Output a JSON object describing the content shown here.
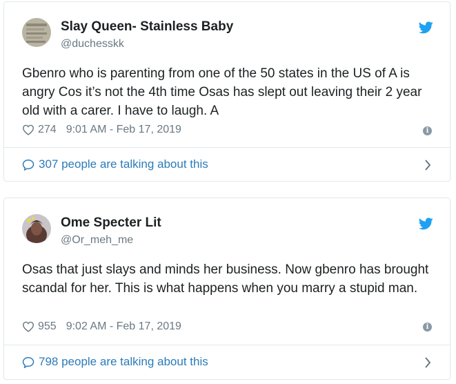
{
  "tweets": [
    {
      "name": "Slay Queen- Stainless Baby",
      "handle": "@duchesskk",
      "text": "Gbenro who is parenting from one of the 50 states in the US of A is angry Cos it’s not the 4th time Osas has slept out leaving their 2 year old with a carer. I have to laugh. A",
      "likes": "274",
      "timestamp": "9:01 AM - Feb 17, 2019",
      "talking": "307 people are talking about this",
      "icons": {
        "like": "heart-icon",
        "info": "info-icon",
        "brand": "twitter-bird-icon",
        "reply": "speech-bubble-icon",
        "more": "chevron-right-icon"
      }
    },
    {
      "name": "Ome Specter Lit",
      "handle": "@Or_meh_me",
      "text": "Osas that just slays and minds her business. Now gbenro has brought scandal for her. This is what happens when you marry a stupid man.",
      "likes": "955",
      "timestamp": "9:02 AM - Feb 17, 2019",
      "talking": "798 people are talking about this",
      "icons": {
        "like": "heart-icon",
        "info": "info-icon",
        "brand": "twitter-bird-icon",
        "reply": "speech-bubble-icon",
        "more": "chevron-right-icon"
      }
    }
  ],
  "colors": {
    "text": "#1c2022",
    "muted": "#697882",
    "link": "#2b7bb9",
    "brand": "#1da1f2",
    "border": "#e1e8ed"
  }
}
